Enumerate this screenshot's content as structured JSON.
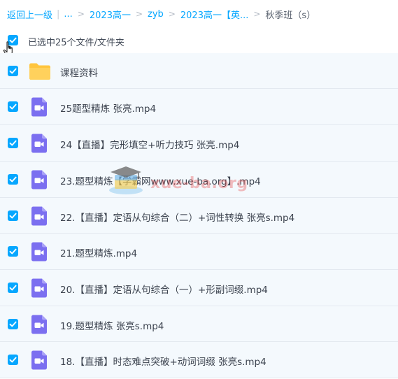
{
  "breadcrumb": {
    "back": "返回上一级",
    "ellipsis": "...",
    "items": [
      "2023高一",
      "zyb",
      "2023高一【英..."
    ],
    "current": "秋季班（s）"
  },
  "selection": {
    "label": "已选中25个文件/文件夹"
  },
  "files": [
    {
      "name": "课程资料",
      "type": "folder"
    },
    {
      "name": "25题型精炼 张亮.mp4",
      "type": "video"
    },
    {
      "name": "24【直播】完形填空+听力技巧 张亮.mp4",
      "type": "video"
    },
    {
      "name": "23.题型精炼【学霸网www.xue-ba.org】.mp4",
      "type": "video"
    },
    {
      "name": "22.【直播】定语从句综合（二）+词性转换 张亮s.mp4",
      "type": "video"
    },
    {
      "name": "21.题型精炼.mp4",
      "type": "video"
    },
    {
      "name": "20.【直播】定语从句综合（一）+形副词缀.mp4",
      "type": "video"
    },
    {
      "name": "19.题型精炼 张亮s.mp4",
      "type": "video"
    },
    {
      "name": "18.【直播】时态难点突破+动词词缀 张亮s.mp4",
      "type": "video"
    }
  ],
  "watermark": {
    "text": "xue-ba.org"
  },
  "colors": {
    "accent": "#06a7ff",
    "folder": "#ffc53d",
    "video": "#7b6ff0",
    "row_bg": "#f4f9fd"
  }
}
